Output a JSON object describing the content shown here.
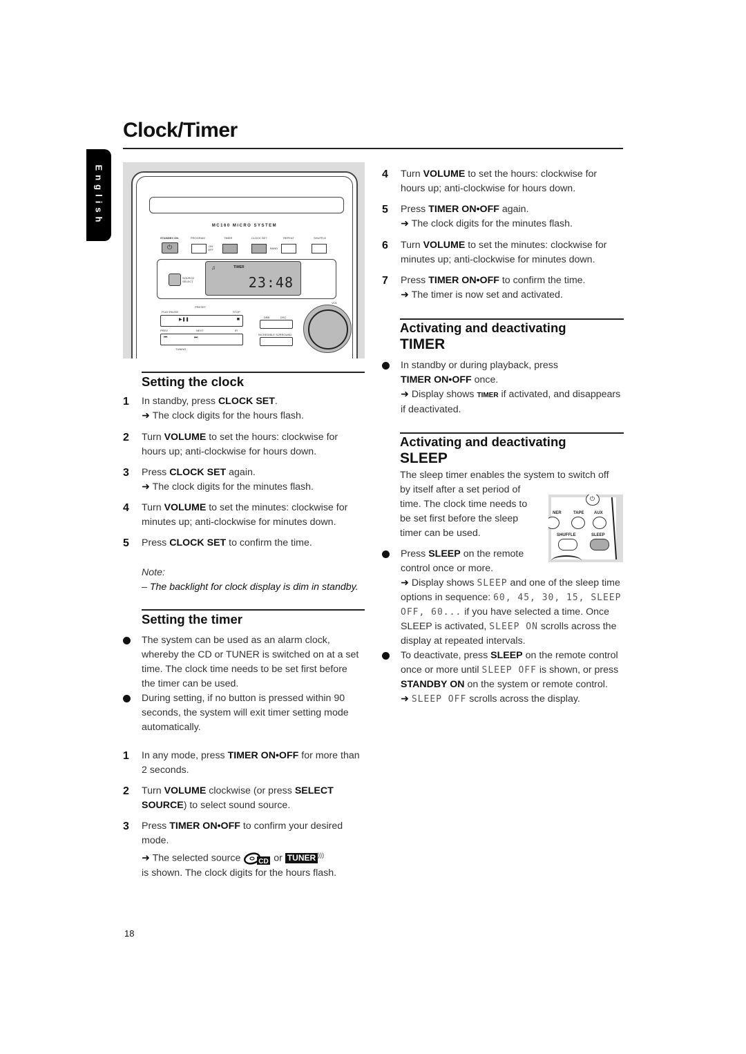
{
  "page": {
    "title": "Clock/Timer",
    "language_tab": "English",
    "page_number": "18"
  },
  "illustration": {
    "model": "MC160 MICRO SYSTEM",
    "buttons": {
      "standby_on": "STANDBY-ON",
      "program": "PROGRAM",
      "timer": "TIMER",
      "on_off": "ON OFF",
      "clock_set": "CLOCK SET",
      "band": "BAND",
      "repeat": "REPEAT",
      "shuffle": "SHUFFLE",
      "source_select": "SOURCE SELECT",
      "preset": "PRESET",
      "play_pause": "PLAY-PAUSE",
      "stop": "STOP",
      "prev": "PREV",
      "next": "NEXT",
      "ir": "IR",
      "dbb": "DBB",
      "dsc": "DSC",
      "incredible_surround": "INCREDIBLE SURROUND",
      "tuning": "TUNING",
      "vol": "VOL"
    },
    "display": {
      "time": "23:48",
      "indicator": "TIMER"
    }
  },
  "setting_clock": {
    "heading": "Setting the clock",
    "steps": [
      {
        "num": "1",
        "pre": "In standby, press ",
        "bold": "CLOCK SET",
        "post": ".",
        "result": "The clock digits for the hours flash."
      },
      {
        "num": "2",
        "pre": "Turn ",
        "bold": "VOLUME",
        "post": " to set the hours: clockwise for hours up; anti-clockwise for hours down."
      },
      {
        "num": "3",
        "pre": "Press ",
        "bold": "CLOCK SET",
        "post": " again.",
        "result": "The clock digits for the minutes flash."
      },
      {
        "num": "4",
        "pre": "Turn ",
        "bold": "VOLUME",
        "post": " to set the minutes: clockwise for minutes up; anti-clockwise for minutes down."
      },
      {
        "num": "5",
        "pre": "Press ",
        "bold": "CLOCK SET",
        "post": " to confirm the time."
      }
    ],
    "note_label": "Note:",
    "note_text": "The backlight for clock display is dim in standby."
  },
  "setting_timer": {
    "heading": "Setting the timer",
    "bullets": [
      "The system can be used as an alarm clock, whereby the CD or TUNER is switched on at a set time. The clock time needs to be set first before the timer can be used.",
      "During setting, if no button is pressed within 90 seconds, the system will exit timer setting mode automatically."
    ],
    "steps": [
      {
        "num": "1",
        "pre": "In any mode, press ",
        "bold": "TIMER ON•OFF",
        "post": " for more than 2 seconds."
      },
      {
        "num": "2",
        "pre": "Turn ",
        "bold": "VOLUME",
        "mid": " clockwise (or press ",
        "bold2": "SELECT SOURCE",
        "post": ") to select sound source."
      },
      {
        "num": "3",
        "pre": "Press ",
        "bold": "TIMER ON•OFF",
        "post": " to confirm your desired mode.",
        "result_pre": "The selected source",
        "cd_label": "CD",
        "or": "or",
        "tuner_label": "TUNER",
        "result_post": "is shown. The clock digits for the hours flash."
      },
      {
        "num": "4",
        "pre": "Turn ",
        "bold": "VOLUME",
        "post": " to set the hours: clockwise for hours up; anti-clockwise for hours down."
      },
      {
        "num": "5",
        "pre": "Press ",
        "bold": "TIMER ON•OFF",
        "post": " again.",
        "result": "The clock digits for the minutes flash."
      },
      {
        "num": "6",
        "pre": "Turn ",
        "bold": "VOLUME",
        "post": " to set the minutes: clockwise for minutes up; anti-clockwise for minutes down."
      },
      {
        "num": "7",
        "pre": "Press ",
        "bold": "TIMER ON•OFF",
        "post": " to confirm the time.",
        "result": "The timer is now set and activated."
      }
    ]
  },
  "activate_timer": {
    "heading_line1": "Activating and deactivating",
    "heading_line2": "TIMER",
    "bullet_pre": "In standby or during playback, press",
    "bullet_bold": "TIMER ON•OFF",
    "bullet_post": " once.",
    "result_pre": "Display shows ",
    "result_indicator": "TIMER",
    "result_post": " if activated, and disappears if deactivated."
  },
  "activate_sleep": {
    "heading_line1": "Activating and deactivating",
    "heading_line2": "SLEEP",
    "intro_line1": "The sleep timer enables the system to switch off",
    "intro_rest": [
      "by itself after a set period of",
      "time. The clock time needs to",
      "be set first before the sleep",
      "timer can be used."
    ],
    "bullet1_pre": "Press ",
    "bullet1_bold": "SLEEP",
    "bullet1_post": " on the remote",
    "bullet1_line2": "control once or more.",
    "result1": {
      "pre": "Display shows ",
      "lcd_sleep": "SLEEP",
      "mid": " and one of the sleep time options in sequence: ",
      "options": "60, 45, 30, 15, SLEEP OFF, 60...",
      "post": " if you have selected a time. Once SLEEP is activated, ",
      "lcd_sleep_on": "SLEEP ON",
      "tail": " scrolls across the display at repeated intervals."
    },
    "bullet2": {
      "pre": "To deactivate, press ",
      "bold": "SLEEP",
      "mid": " on the remote control once or more until ",
      "lcd": "SLEEP OFF",
      "mid2": " is shown, or press ",
      "bold2": "STANDBY ON",
      "post": " on the system or remote control."
    },
    "result2": {
      "lcd": "SLEEP OFF",
      "post": " scrolls across the display."
    },
    "remote": {
      "tuner": "NER",
      "tape": "TAPE",
      "aux": "AUX",
      "shuffle": "SHUFFLE",
      "sleep": "SLEEP"
    }
  }
}
